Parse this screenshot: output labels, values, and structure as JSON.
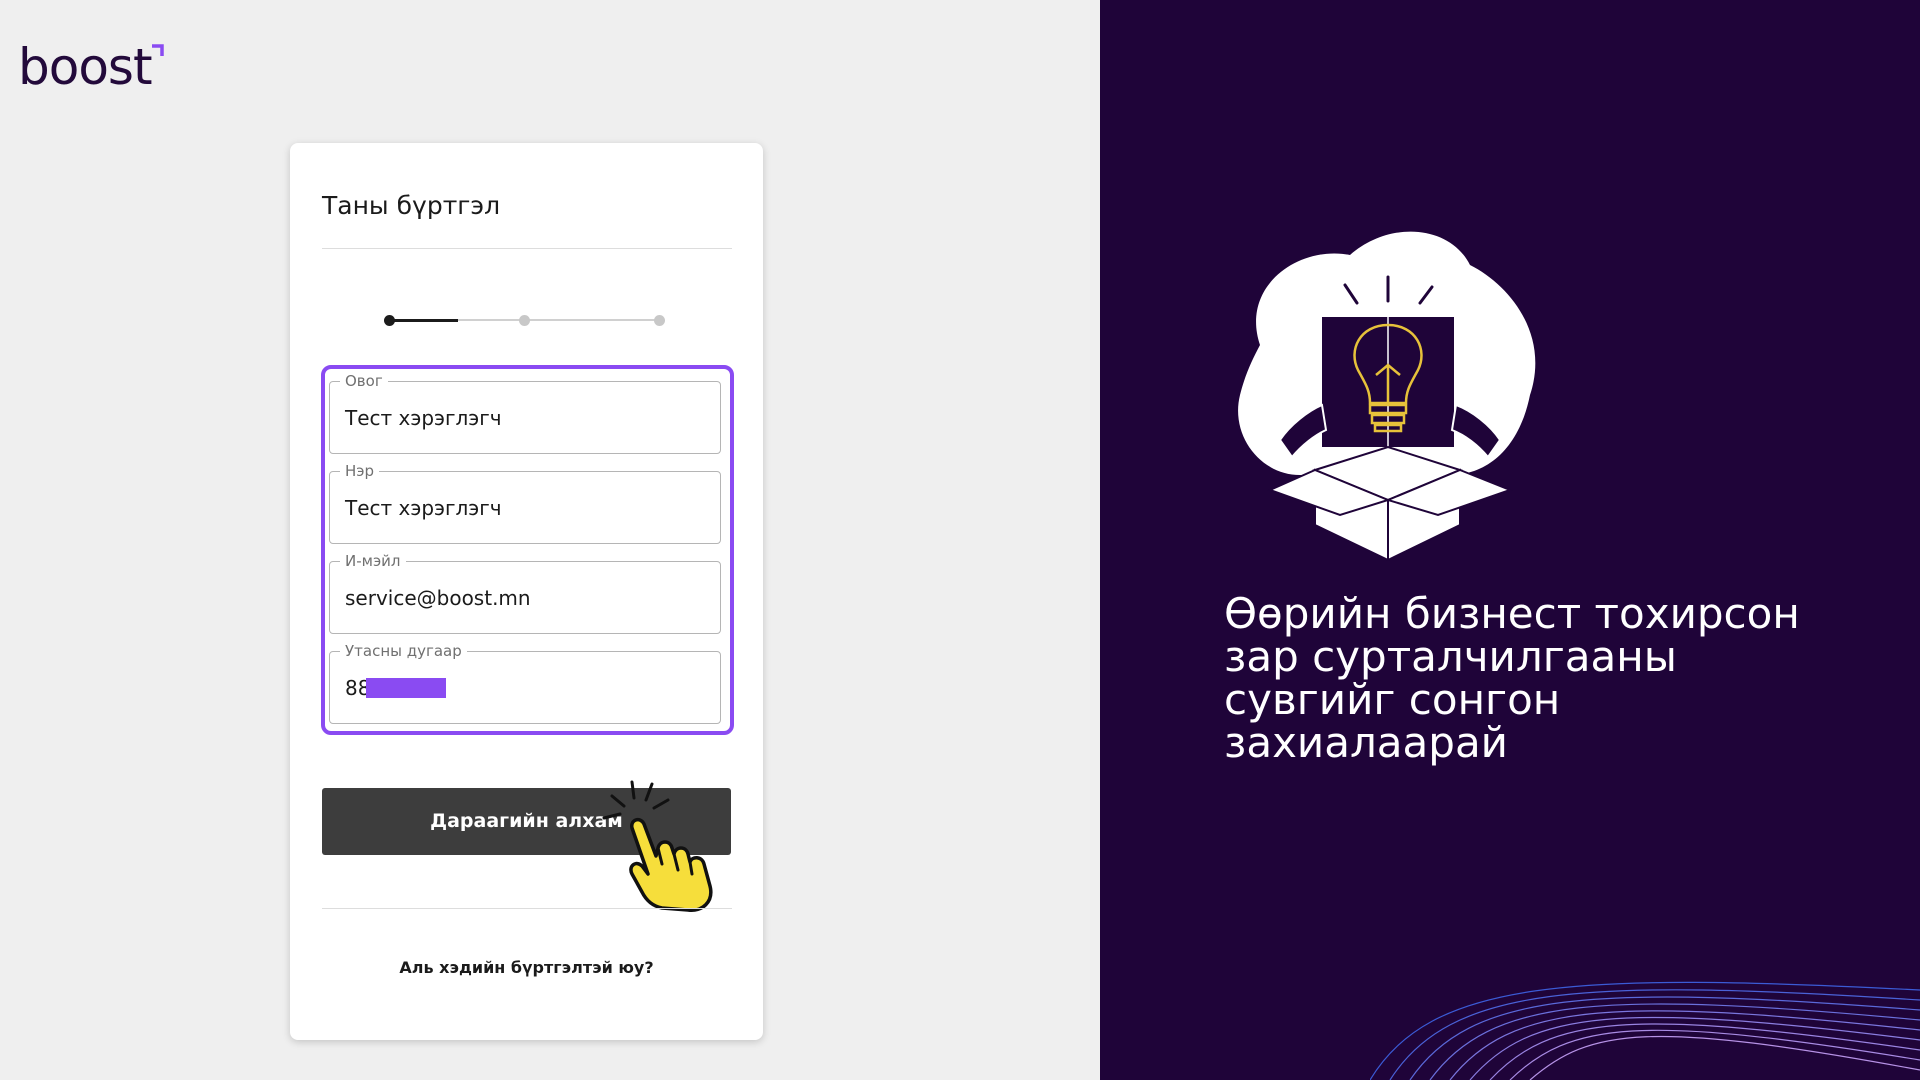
{
  "brand": {
    "logo_text": "boost",
    "accent": "#8a4bf2",
    "dark": "#1f0439"
  },
  "form": {
    "title": "Таны бүртгэл",
    "stepper": {
      "current_step": 1,
      "total_steps": 3
    },
    "fields": [
      {
        "label": "Овог",
        "value": "Тест хэрэглэгч"
      },
      {
        "label": "Нэр",
        "value": "Тест хэрэглэгч"
      },
      {
        "label": "И-мэйл",
        "value": "service@boost.mn"
      },
      {
        "label": "Утасны дугаар",
        "value": "88"
      }
    ],
    "next_button": "Дараагийн алхам",
    "login_link": "Аль хэдийн бүртгэлтэй юу?"
  },
  "promo": {
    "tagline": "Өөрийн бизнест тохирсон зар сурталчилгааны сувгийг сонгон захиалаарай"
  },
  "icons": {
    "logo_mark": "corner-mark-icon",
    "illustration": "lightbulb-box-illustration",
    "cursor": "pointer-hand-icon"
  }
}
